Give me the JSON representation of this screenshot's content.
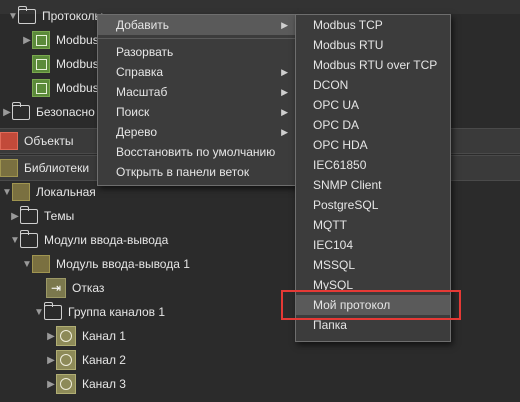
{
  "tree": {
    "protocols": "Протоколы",
    "modbus_items": [
      "Modbus",
      "Modbus",
      "Modbus"
    ],
    "security": "Безопасно",
    "objects": "Объекты",
    "libraries": "Библиотеки",
    "local": "Локальная",
    "themes": "Темы",
    "io_modules": "Модули ввода-вывода",
    "io_module_1": "Модуль ввода-вывода 1",
    "fail": "Отказ",
    "channel_group": "Группа каналов 1",
    "channels": [
      "Канал 1",
      "Канал 2",
      "Канал 3"
    ]
  },
  "context_menu": {
    "add": "Добавить",
    "unfold": "Разорвать",
    "help": "Справка",
    "scale": "Масштаб",
    "search": "Поиск",
    "tree": "Дерево",
    "restore_default": "Восстановить по умолчанию",
    "open_in_branch_panel": "Открыть в панели веток"
  },
  "submenu": {
    "items": [
      "Modbus TCP",
      "Modbus RTU",
      "Modbus RTU over TCP",
      "DCON",
      "OPC UA",
      "OPC DA",
      "OPC HDA",
      "IEC61850",
      "SNMP Client",
      "PostgreSQL",
      "MQTT",
      "IEC104",
      "MSSQL",
      "MySQL",
      "Мой протокол",
      "Папка"
    ],
    "highlighted_index": 14
  },
  "colors": {
    "highlight_box": "#e53935",
    "menu_bg": "#3c3c3c",
    "panel_bg": "#2b2b2b"
  }
}
